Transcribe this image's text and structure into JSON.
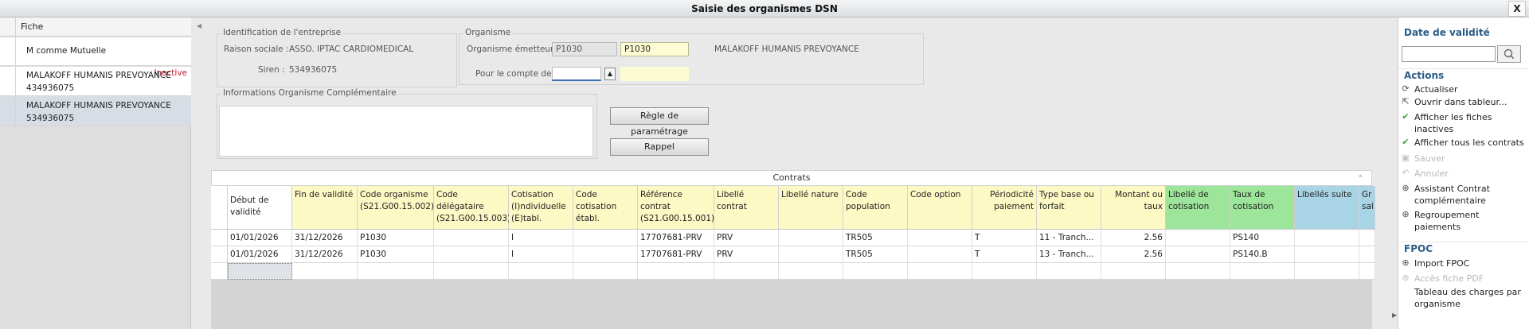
{
  "window": {
    "title": "Saisie des organismes DSN",
    "close_label": "X"
  },
  "left_panel": {
    "header": "Fiche",
    "items": [
      {
        "line1": "M comme Mutuelle",
        "line2": "",
        "badge": ""
      },
      {
        "line1": "MALAKOFF HUMANIS PREVOYANCE",
        "line2": "434936075",
        "badge": "Inactive"
      },
      {
        "line1": "MALAKOFF HUMANIS PREVOYANCE",
        "line2": "534936075",
        "badge": ""
      }
    ]
  },
  "identification": {
    "group_label": "Identification de l'entreprise",
    "raison_sociale_label": "Raison sociale :",
    "raison_sociale_value": "ASSO. IPTAC CARDIOMEDICAL",
    "siren_label": "Siren :",
    "siren_value": "534936075"
  },
  "organisme": {
    "group_label": "Organisme",
    "emetteur_label": "Organisme émetteur :",
    "emetteur_code": "P1030",
    "emetteur_code_edit": "P1030",
    "emetteur_name": "MALAKOFF HUMANIS PREVOYANCE",
    "compte_label": "Pour le compte de :",
    "compte_value": ""
  },
  "info_complementaire": {
    "group_label": "Informations Organisme Complémentaire"
  },
  "buttons": {
    "regle": "Règle de paramétrage",
    "rappel": "Rappel"
  },
  "contrats": {
    "title": "Contrats",
    "scroll_glyph": "⌃",
    "columns": [
      {
        "label": "Début de validité",
        "style": "white"
      },
      {
        "label": "Fin de validité",
        "style": "yellow"
      },
      {
        "label": "Code organisme (S21.G00.15.002)",
        "style": "yellow"
      },
      {
        "label": "Code délégataire (S21.G00.15.003)",
        "style": "yellow"
      },
      {
        "label": "Cotisation (I)ndividuelle (E)tabl.",
        "style": "yellow"
      },
      {
        "label": "Code cotisation établ.",
        "style": "yellow"
      },
      {
        "label": "Référence contrat (S21.G00.15.001)",
        "style": "yellow"
      },
      {
        "label": "Libellé contrat",
        "style": "yellow"
      },
      {
        "label": "Libellé nature",
        "style": "yellow"
      },
      {
        "label": "Code population",
        "style": "yellow"
      },
      {
        "label": "Code option",
        "style": "yellow"
      },
      {
        "label": "Périodicité paiement",
        "style": "yellow"
      },
      {
        "label": "Type base ou forfait",
        "style": "yellow"
      },
      {
        "label": "Montant ou taux",
        "style": "yellow"
      },
      {
        "label": "Libellé de cotisation",
        "style": "green"
      },
      {
        "label": "Taux de cotisation",
        "style": "green"
      },
      {
        "label": "Libellés suite",
        "style": "blue"
      },
      {
        "label": "Gr sal",
        "style": "blue"
      }
    ],
    "rows": [
      [
        "01/01/2026",
        "31/12/2026",
        "P1030",
        "",
        "I",
        "",
        "17707681-PRV",
        "PRV",
        "",
        "TR505",
        "",
        "T",
        "11 - Tranch...",
        "2.56",
        "",
        "PS140",
        "",
        ""
      ],
      [
        "01/01/2026",
        "31/12/2026",
        "P1030",
        "",
        "I",
        "",
        "17707681-PRV",
        "PRV",
        "",
        "TR505",
        "",
        "T",
        "13 - Tranch...",
        "2.56",
        "",
        "PS140.B",
        "",
        ""
      ]
    ]
  },
  "right_panel": {
    "date_title": "Date de validité",
    "date_value": "",
    "actions_title": "Actions",
    "actions": [
      {
        "icon": "refresh-icon",
        "label": "Actualiser",
        "enabled": true
      },
      {
        "icon": "export-icon",
        "label": "Ouvrir dans tableur...",
        "enabled": true
      },
      {
        "icon": "check-icon",
        "label": "Afficher les fiches inactives",
        "enabled": true
      },
      {
        "icon": "check-icon",
        "label": "Afficher tous les contrats",
        "enabled": true
      },
      {
        "icon": "save-icon",
        "label": "Sauver",
        "enabled": false
      },
      {
        "icon": "undo-icon",
        "label": "Annuler",
        "enabled": false
      },
      {
        "icon": "add-icon",
        "label": "Assistant Contrat complémentaire",
        "enabled": true
      },
      {
        "icon": "add-icon",
        "label": "Regroupement paiements",
        "enabled": true
      }
    ],
    "fpoc_title": "FPOC",
    "fpoc_actions": [
      {
        "icon": "add-icon",
        "label": "Import FPOC",
        "enabled": true
      },
      {
        "icon": "add-icon",
        "label": "Accès fiche PDF",
        "enabled": false
      },
      {
        "icon": "",
        "label": "Tableau des charges par organisme",
        "enabled": true
      }
    ]
  }
}
